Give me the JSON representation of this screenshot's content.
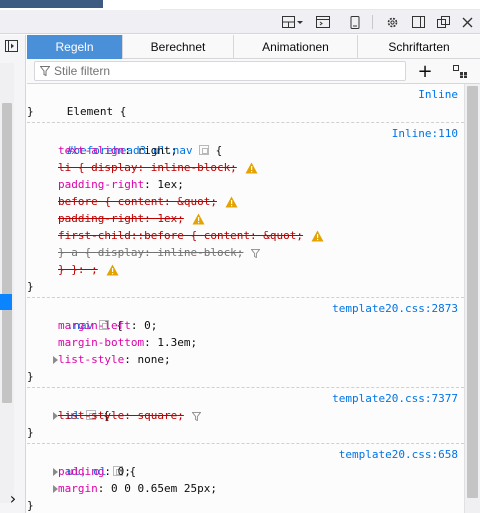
{
  "toolbar": {
    "icons": [
      "dock-layout-icon",
      "split-console-icon",
      "responsive-design-icon",
      "settings-icon",
      "dock-side-icon",
      "popout-icon",
      "close-icon"
    ]
  },
  "tabs": [
    {
      "label": "Regeln",
      "active": true
    },
    {
      "label": "Berechnet",
      "active": false
    },
    {
      "label": "Animationen",
      "active": false
    },
    {
      "label": "Schriftarten",
      "active": false
    }
  ],
  "filter": {
    "placeholder": "Stile filtern",
    "add_label": "+"
  },
  "rules": [
    {
      "selector": "Element {",
      "source": "Inline",
      "close": "}",
      "declarations": []
    },
    {
      "selector": "#beforehead3 ul.nav",
      "source": "Inline:110",
      "open": "{",
      "close": "}",
      "declarations": [
        {
          "text": "text-align: right;",
          "prop": "text-align",
          "val": "right",
          "struck": false
        },
        {
          "text": "li { display: inline-block;",
          "struck": true,
          "warn": true
        },
        {
          "text": "padding-right: 1ex;",
          "prop": "padding-right",
          "val": "1ex",
          "struck": false
        },
        {
          "text": "before { content: &quot;",
          "struck": true,
          "warn": true
        },
        {
          "text": "padding-right: 1ex;",
          "struck": true,
          "warn": true
        },
        {
          "text": "first-child::before { content: &quot;",
          "struck": true,
          "warn": true
        },
        {
          "text": "} a { display: inline-block;",
          "struck": true,
          "filter": true
        },
        {
          "text": "} }: ;",
          "struck": true,
          "warn": true
        }
      ]
    },
    {
      "selector": ".nav",
      "source": "template20.css:2873",
      "open": "{",
      "close": "}",
      "declarations": [
        {
          "prop": "margin-left",
          "val": "0",
          "struck": false
        },
        {
          "prop": "margin-bottom",
          "val": "1.3em",
          "struck": false
        },
        {
          "prop": "list-style",
          "val": "none",
          "struck": false,
          "twisty": true
        }
      ]
    },
    {
      "selector": "ul",
      "source": "template20.css:7377",
      "open": "{",
      "close": "}",
      "declarations": [
        {
          "prop": "list-style",
          "val": "square",
          "struck": true,
          "twisty": true,
          "filter": true
        }
      ]
    },
    {
      "selector": "ul, ol",
      "source": "template20.css:658",
      "open": "{",
      "close": "}",
      "declarations": [
        {
          "prop": "padding",
          "val": "0",
          "struck": false,
          "twisty": true
        },
        {
          "prop": "margin",
          "val": "0 0 0.65em 25px",
          "struck": false,
          "twisty": true
        }
      ]
    }
  ]
}
